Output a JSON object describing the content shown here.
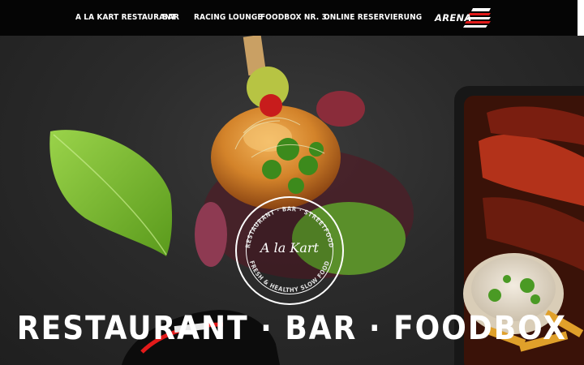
{
  "nav": {
    "items": [
      {
        "label": "A LA KART RESTAURANT"
      },
      {
        "label": "BAR"
      },
      {
        "label": "RACING LOUNGE"
      },
      {
        "label": "FOODBOX NR. 3"
      },
      {
        "label": "ONLINE RESERVIERUNG"
      }
    ],
    "logo_text": "ARENA"
  },
  "hero": {
    "badge": {
      "top_text": "RESTAURANT · BAR · STREETFOOD",
      "script_text": "A la Kart",
      "bottom_text": "FRESH & HEALTHY SLOW FOOD"
    },
    "headline": "RESTAURANT · BAR · FOODBOX"
  },
  "colors": {
    "topbar": "#050505",
    "background": "#2b2b2b",
    "basil": "#7dbb2e",
    "bun": "#d98a2c",
    "accent_red": "#e21a1a"
  }
}
